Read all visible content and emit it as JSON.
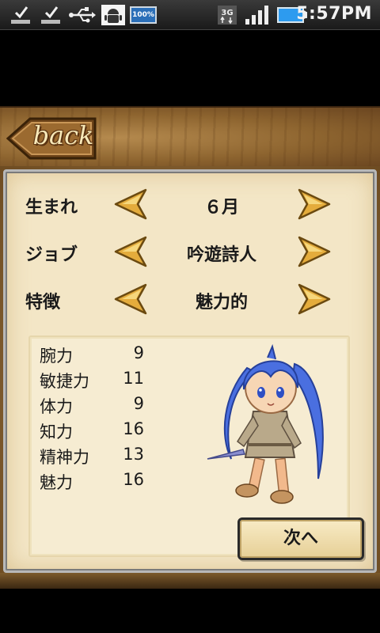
{
  "status_bar": {
    "battery_label": "100%",
    "network_label": "3G",
    "time": "5:57PM",
    "icons": [
      "check-icon",
      "check-icon",
      "usb-icon",
      "android-debug-icon",
      "battery-percent-icon",
      "3g-icon",
      "signal-icon",
      "battery-icon"
    ]
  },
  "header": {
    "back_label": "back"
  },
  "selectors": [
    {
      "label": "生まれ",
      "value": "６月"
    },
    {
      "label": "ジョブ",
      "value": "吟遊詩人"
    },
    {
      "label": "特徴",
      "value": "魅力的"
    }
  ],
  "stats": [
    {
      "name": "腕力",
      "value": "9"
    },
    {
      "name": "敏捷力",
      "value": "11"
    },
    {
      "name": "体力",
      "value": "9"
    },
    {
      "name": "知力",
      "value": "16"
    },
    {
      "name": "精神力",
      "value": "13"
    },
    {
      "name": "魅力",
      "value": "16"
    }
  ],
  "next_button": {
    "label": "次へ"
  },
  "colors": {
    "parchment": "#f3e6c6",
    "arrow_gold": "#e0a83a",
    "wood": "#8d642f",
    "character_hair": "#4a6fe0"
  }
}
